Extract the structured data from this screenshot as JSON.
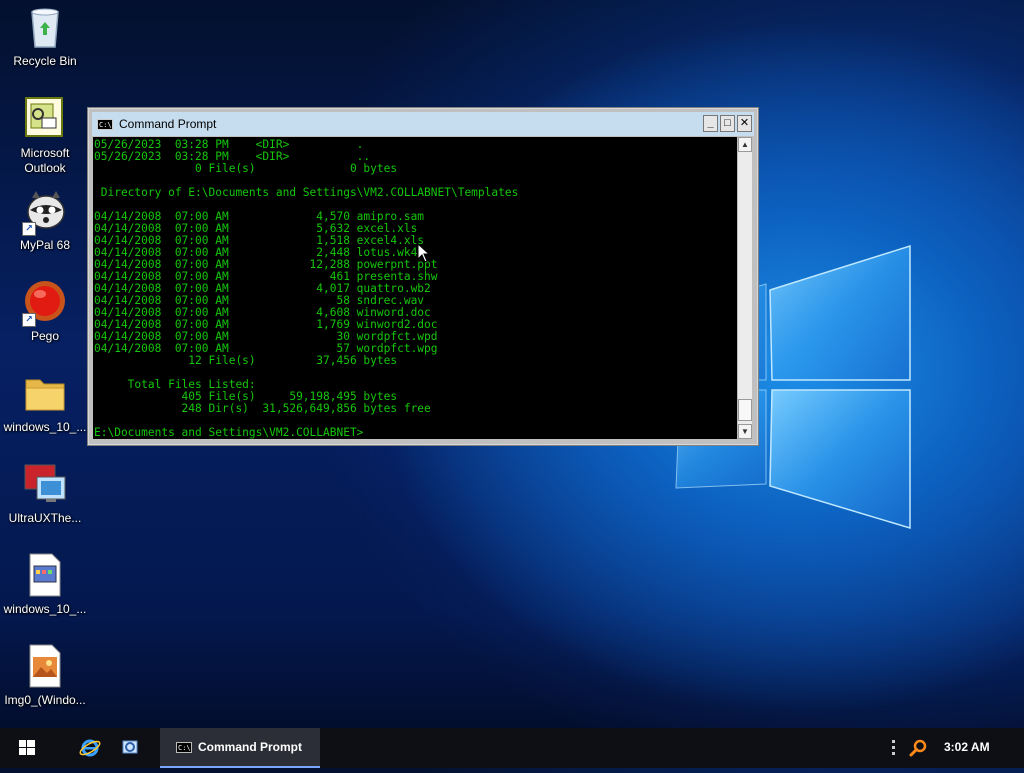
{
  "desktop": {
    "icons": [
      {
        "label": "Recycle Bin",
        "icon": "recycle-bin-icon"
      },
      {
        "label": "Microsoft Outlook",
        "label_line1": "Microsoft",
        "label_line2": "Outlook",
        "icon": "outlook-icon"
      },
      {
        "label": "MyPal 68",
        "icon": "mypal-icon"
      },
      {
        "label": "Pego",
        "icon": "pego-icon"
      },
      {
        "label": "windows_10_...",
        "icon": "folder-icon"
      },
      {
        "label": "UltraUXThe...",
        "icon": "ultrauxtheme-icon"
      },
      {
        "label": "windows_10_...",
        "icon": "document-icon"
      },
      {
        "label": "Img0_(Windo...",
        "icon": "image-file-icon"
      }
    ]
  },
  "window": {
    "title": "Command Prompt",
    "icon_text": "C:\\",
    "buttons": {
      "minimize": "_",
      "maximize": "□",
      "close": "✕"
    },
    "console_lines": [
      "05/26/2023  03:28 PM    <DIR>          .",
      "05/26/2023  03:28 PM    <DIR>          ..",
      "               0 File(s)              0 bytes",
      "",
      " Directory of E:\\Documents and Settings\\VM2.COLLABNET\\Templates",
      "",
      "04/14/2008  07:00 AM             4,570 amipro.sam",
      "04/14/2008  07:00 AM             5,632 excel.xls",
      "04/14/2008  07:00 AM             1,518 excel4.xls",
      "04/14/2008  07:00 AM             2,448 lotus.wk4",
      "04/14/2008  07:00 AM            12,288 powerpnt.ppt",
      "04/14/2008  07:00 AM               461 presenta.shw",
      "04/14/2008  07:00 AM             4,017 quattro.wb2",
      "04/14/2008  07:00 AM                58 sndrec.wav",
      "04/14/2008  07:00 AM             4,608 winword.doc",
      "04/14/2008  07:00 AM             1,769 winword2.doc",
      "04/14/2008  07:00 AM                30 wordpfct.wpd",
      "04/14/2008  07:00 AM                57 wordpfct.wpg",
      "              12 File(s)         37,456 bytes",
      "",
      "     Total Files Listed:",
      "             405 File(s)     59,198,495 bytes",
      "             248 Dir(s)  31,526,649,856 bytes free",
      "",
      "E:\\Documents and Settings\\VM2.COLLABNET>"
    ]
  },
  "taskbar": {
    "task_label": "Command Prompt",
    "task_icon_text": "C:\\",
    "clock": "3:02 AM"
  },
  "colors": {
    "console_text": "#16c60c",
    "titlebar": "#c6ddef",
    "taskbar": "#0d0f14"
  }
}
